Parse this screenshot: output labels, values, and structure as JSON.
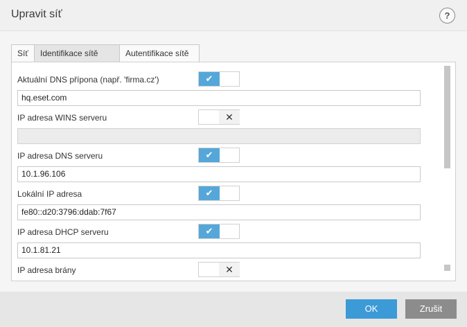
{
  "dialog": {
    "title": "Upravit síť",
    "help_label": "?"
  },
  "tabs": [
    {
      "label": "Síť",
      "active": false
    },
    {
      "label": "Identifikace sítě",
      "active": true
    },
    {
      "label": "Autentifikace sítě",
      "active": false
    }
  ],
  "rows": [
    {
      "label": "Aktuální DNS přípona (např. 'firma.cz')",
      "enabled": true,
      "check": "✔",
      "value": "hq.eset.com"
    },
    {
      "label": "IP adresa WINS serveru",
      "enabled": false,
      "cross": "✕",
      "value": ""
    },
    {
      "label": "IP adresa DNS serveru",
      "enabled": true,
      "check": "✔",
      "value": "10.1.96.106"
    },
    {
      "label": "Lokální IP adresa",
      "enabled": true,
      "check": "✔",
      "value": "fe80::d20:3796:ddab:7f67"
    },
    {
      "label": "IP adresa DHCP serveru",
      "enabled": true,
      "check": "✔",
      "value": "10.1.81.21"
    },
    {
      "label": "IP adresa brány",
      "enabled": false,
      "cross": "✕"
    }
  ],
  "buttons": {
    "ok": "OK",
    "cancel": "Zrušit"
  },
  "colors": {
    "accent": "#3c9bd6",
    "toggle_on": "#55a7d9",
    "cancel": "#8c8c8c"
  }
}
